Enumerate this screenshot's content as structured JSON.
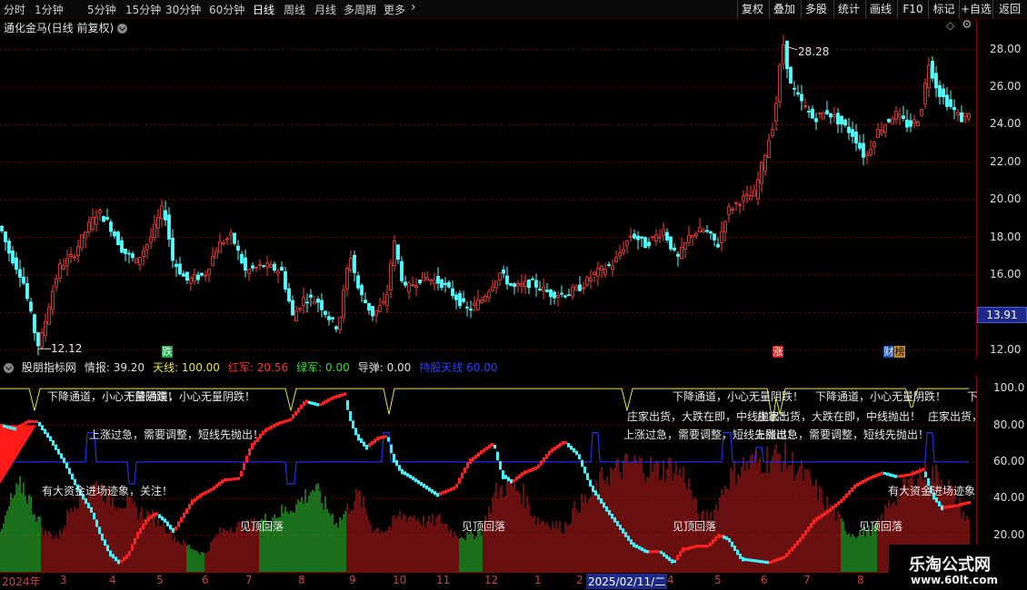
{
  "toolbar": {
    "timeframes": [
      "分时",
      "1分钟",
      "5分钟",
      "15分钟",
      "30分钟",
      "60分钟",
      "日线",
      "周线",
      "月线",
      "多周期",
      "更多"
    ],
    "active_timeframe": "日线",
    "buttons": [
      "复权",
      "叠加",
      "多股",
      "统计",
      "画线",
      "F10",
      "标记",
      "+自选",
      "返回"
    ]
  },
  "stock": {
    "title": "通化金马(日线 前复权)",
    "last_price": "13.91",
    "high_label": "28.28",
    "low_label": "12.12",
    "yticks": [
      "28.00",
      "26.00",
      "24.00",
      "22.00",
      "20.00",
      "18.00",
      "16.00",
      "14.00",
      "12.00"
    ]
  },
  "event_tags": [
    {
      "text": "跌",
      "color": "#1fa34a",
      "fg": "#ffffff"
    },
    {
      "text": "涨",
      "color": "#c8201c",
      "fg": "#ffffff"
    },
    {
      "text": "财",
      "color": "#1c4fb8",
      "fg": "#ffffff"
    },
    {
      "text": "榜",
      "color": "#c98a1a",
      "fg": "#111111"
    }
  ],
  "indicator": {
    "name": "股朋指标网",
    "items": [
      {
        "label": "情报:",
        "value": "39.20",
        "color": "#e0e0e0"
      },
      {
        "label": "天线:",
        "value": "100.00",
        "color": "#e8e82a"
      },
      {
        "label": "红军:",
        "value": "20.56",
        "color": "#ff3030"
      },
      {
        "label": "绿军:",
        "value": "0.00",
        "color": "#30e030"
      },
      {
        "label": "导弹:",
        "value": "0.00",
        "color": "#e0e0e0"
      },
      {
        "label": "持股天线",
        "value": "60.00",
        "color": "#3040ff"
      }
    ],
    "yticks": [
      "100.0",
      "80.00",
      "60.00",
      "40.00",
      "20.00"
    ]
  },
  "signals": {
    "down_channel": "下降通道，小心无量阴跌！",
    "rise_pullback": "上涨过急，需要调整，短线先抛出！",
    "dealer_sell": "庄家出货，大跌在即，中线抛出！",
    "funds_enter": "有大资金进场迹象，关注！",
    "funds_enter_short": "有大资金进场迹象",
    "top_fall": "见顶回落"
  },
  "xaxis": {
    "labels": [
      "2024年",
      "3",
      "4",
      "5",
      "6",
      "7",
      "8",
      "9",
      "10",
      "11",
      "12",
      "1",
      "2",
      "2025/02/11/二",
      "4",
      "5",
      "6",
      "7",
      "8"
    ]
  },
  "watermark": {
    "title": "乐淘公式网",
    "url": "www.60lt.com"
  },
  "chart_data": {
    "type": "candlestick",
    "title": "通化金马(日线 前复权)",
    "ylim": [
      11.6,
      28.9
    ],
    "price_path": [
      [
        0,
        18.6
      ],
      [
        10,
        17.2
      ],
      [
        25,
        15.8
      ],
      [
        38,
        13.0
      ],
      [
        43,
        12.12
      ],
      [
        55,
        14.6
      ],
      [
        65,
        16.4
      ],
      [
        80,
        17.0
      ],
      [
        95,
        18.4
      ],
      [
        108,
        19.4
      ],
      [
        120,
        18.7
      ],
      [
        135,
        17.3
      ],
      [
        150,
        16.7
      ],
      [
        165,
        17.9
      ],
      [
        180,
        19.7
      ],
      [
        190,
        16.8
      ],
      [
        205,
        15.7
      ],
      [
        225,
        16.0
      ],
      [
        240,
        17.6
      ],
      [
        255,
        18.1
      ],
      [
        270,
        16.2
      ],
      [
        290,
        16.5
      ],
      [
        310,
        16.2
      ],
      [
        322,
        13.8
      ],
      [
        335,
        14.8
      ],
      [
        350,
        14.6
      ],
      [
        365,
        13.5
      ],
      [
        372,
        13.2
      ],
      [
        385,
        17.2
      ],
      [
        395,
        15.1
      ],
      [
        410,
        13.9
      ],
      [
        425,
        14.6
      ],
      [
        433,
        17.9
      ],
      [
        445,
        15.2
      ],
      [
        465,
        15.9
      ],
      [
        485,
        15.6
      ],
      [
        500,
        14.9
      ],
      [
        515,
        14.1
      ],
      [
        530,
        14.7
      ],
      [
        550,
        16.1
      ],
      [
        565,
        15.3
      ],
      [
        585,
        15.6
      ],
      [
        605,
        15.0
      ],
      [
        625,
        15.0
      ],
      [
        640,
        15.4
      ],
      [
        655,
        16.1
      ],
      [
        675,
        16.6
      ],
      [
        695,
        18.2
      ],
      [
        710,
        17.6
      ],
      [
        730,
        18.4
      ],
      [
        745,
        16.8
      ],
      [
        760,
        18.2
      ],
      [
        775,
        18.4
      ],
      [
        790,
        17.6
      ],
      [
        800,
        19.4
      ],
      [
        815,
        20.0
      ],
      [
        830,
        20.3
      ],
      [
        842,
        22.5
      ],
      [
        852,
        24.3
      ],
      [
        858,
        27.0
      ],
      [
        862,
        28.28
      ],
      [
        870,
        26.1
      ],
      [
        880,
        25.3
      ],
      [
        895,
        24.3
      ],
      [
        910,
        24.7
      ],
      [
        925,
        24.1
      ],
      [
        940,
        23.4
      ],
      [
        952,
        22.2
      ],
      [
        965,
        23.6
      ],
      [
        985,
        24.6
      ],
      [
        1000,
        23.9
      ],
      [
        1012,
        24.4
      ],
      [
        1022,
        27.3
      ],
      [
        1032,
        25.8
      ],
      [
        1045,
        25.0
      ],
      [
        1058,
        24.3
      ],
      [
        1066,
        24.7
      ]
    ],
    "indicator_series": [
      {
        "name": "天线",
        "color": "#e8e82a",
        "value": 100.0
      },
      {
        "name": "红军",
        "color": "#ff3030",
        "value": 20.56
      },
      {
        "name": "绿军",
        "color": "#30e030",
        "value": 0.0
      },
      {
        "name": "持股天线",
        "color": "#3040ff",
        "value": 60.0
      }
    ],
    "indicator_ylim": [
      0,
      110
    ],
    "main_line": [
      [
        0,
        80
      ],
      [
        15,
        78
      ],
      [
        30,
        82
      ],
      [
        40,
        82
      ],
      [
        55,
        72
      ],
      [
        70,
        60
      ],
      [
        85,
        45
      ],
      [
        100,
        33
      ],
      [
        110,
        20
      ],
      [
        120,
        10
      ],
      [
        130,
        5
      ],
      [
        140,
        9
      ],
      [
        150,
        20
      ],
      [
        160,
        28
      ],
      [
        170,
        32
      ],
      [
        180,
        28
      ],
      [
        190,
        22
      ],
      [
        200,
        30
      ],
      [
        210,
        38
      ],
      [
        220,
        42
      ],
      [
        232,
        45
      ],
      [
        245,
        50
      ],
      [
        262,
        51
      ],
      [
        275,
        68
      ],
      [
        290,
        77
      ],
      [
        305,
        81
      ],
      [
        318,
        83
      ],
      [
        335,
        93
      ],
      [
        350,
        91
      ],
      [
        365,
        95
      ],
      [
        378,
        97
      ],
      [
        385,
        83
      ],
      [
        392,
        74
      ],
      [
        402,
        68
      ],
      [
        415,
        73
      ],
      [
        425,
        74
      ],
      [
        432,
        62
      ],
      [
        440,
        55
      ],
      [
        450,
        52
      ],
      [
        465,
        47
      ],
      [
        480,
        42
      ],
      [
        500,
        46
      ],
      [
        515,
        60
      ],
      [
        530,
        66
      ],
      [
        542,
        70
      ],
      [
        552,
        53
      ],
      [
        562,
        49
      ],
      [
        575,
        54
      ],
      [
        590,
        57
      ],
      [
        605,
        66
      ],
      [
        620,
        71
      ],
      [
        635,
        64
      ],
      [
        650,
        46
      ],
      [
        665,
        35
      ],
      [
        680,
        25
      ],
      [
        695,
        15
      ],
      [
        710,
        11
      ],
      [
        725,
        11
      ],
      [
        740,
        5
      ],
      [
        750,
        12
      ],
      [
        765,
        14
      ],
      [
        778,
        14
      ],
      [
        790,
        20
      ],
      [
        800,
        18
      ],
      [
        815,
        7
      ],
      [
        830,
        6
      ],
      [
        845,
        5
      ],
      [
        862,
        8
      ],
      [
        880,
        18
      ],
      [
        895,
        28
      ],
      [
        910,
        33
      ],
      [
        925,
        39
      ],
      [
        940,
        47
      ],
      [
        955,
        51
      ],
      [
        970,
        54
      ],
      [
        985,
        52
      ],
      [
        1000,
        53
      ],
      [
        1015,
        56
      ],
      [
        1025,
        42
      ],
      [
        1035,
        35
      ],
      [
        1050,
        36
      ],
      [
        1066,
        38
      ]
    ],
    "blue_line_baseline": 60.0,
    "yellow_line_baseline": 100.0,
    "histogram": [
      [
        0,
        20
      ],
      [
        12,
        40
      ],
      [
        25,
        50
      ],
      [
        35,
        38
      ],
      [
        50,
        22
      ],
      [
        65,
        20
      ],
      [
        80,
        40
      ],
      [
        95,
        45
      ],
      [
        108,
        50
      ],
      [
        120,
        42
      ],
      [
        135,
        40
      ],
      [
        150,
        35
      ],
      [
        165,
        32
      ],
      [
        180,
        28
      ],
      [
        195,
        18
      ],
      [
        210,
        14
      ],
      [
        225,
        10
      ],
      [
        240,
        22
      ],
      [
        255,
        26
      ],
      [
        270,
        26
      ],
      [
        285,
        28
      ],
      [
        300,
        32
      ],
      [
        315,
        35
      ],
      [
        330,
        40
      ],
      [
        345,
        48
      ],
      [
        360,
        36
      ],
      [
        372,
        28
      ],
      [
        385,
        38
      ],
      [
        395,
        44
      ],
      [
        410,
        25
      ],
      [
        425,
        24
      ],
      [
        440,
        32
      ],
      [
        455,
        32
      ],
      [
        470,
        28
      ],
      [
        485,
        30
      ],
      [
        500,
        22
      ],
      [
        515,
        20
      ],
      [
        530,
        24
      ],
      [
        545,
        45
      ],
      [
        560,
        50
      ],
      [
        575,
        45
      ],
      [
        590,
        30
      ],
      [
        605,
        28
      ],
      [
        620,
        25
      ],
      [
        635,
        38
      ],
      [
        650,
        42
      ],
      [
        665,
        55
      ],
      [
        680,
        58
      ],
      [
        695,
        62
      ],
      [
        710,
        60
      ],
      [
        725,
        58
      ],
      [
        740,
        60
      ],
      [
        755,
        54
      ],
      [
        770,
        30
      ],
      [
        785,
        34
      ],
      [
        800,
        52
      ],
      [
        815,
        60
      ],
      [
        830,
        62
      ],
      [
        845,
        65
      ],
      [
        860,
        66
      ],
      [
        875,
        60
      ],
      [
        890,
        52
      ],
      [
        905,
        42
      ],
      [
        920,
        32
      ],
      [
        935,
        22
      ],
      [
        950,
        22
      ],
      [
        965,
        26
      ],
      [
        980,
        40
      ],
      [
        995,
        48
      ],
      [
        1010,
        56
      ],
      [
        1025,
        56
      ],
      [
        1040,
        52
      ],
      [
        1055,
        38
      ],
      [
        1066,
        28
      ]
    ]
  }
}
